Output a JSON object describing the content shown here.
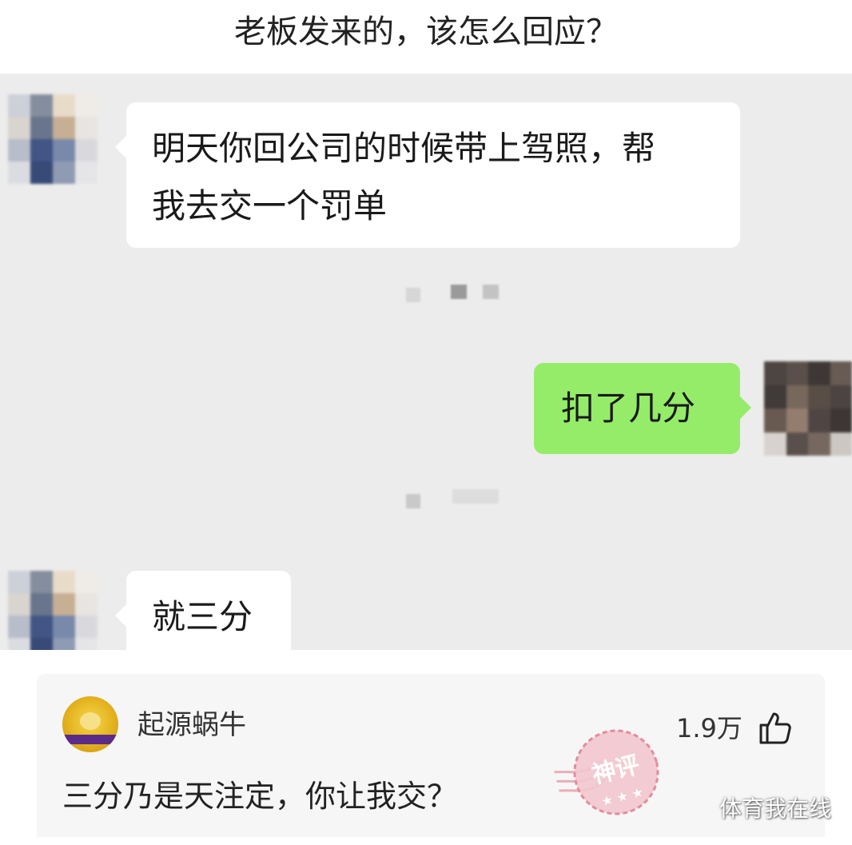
{
  "post": {
    "title": "老板发来的，该怎么回应？"
  },
  "chat": {
    "messages": [
      {
        "side": "left",
        "text_line1": "明天你回公司的时候带上驾照，帮",
        "text_line2": "我去交一个罚单"
      },
      {
        "side": "right",
        "text": "扣了几分"
      },
      {
        "side": "left",
        "text": "就三分"
      }
    ]
  },
  "comment": {
    "username": "起源蜗牛",
    "likes": "1.9万",
    "text": "三分乃是天注定，你让我交？",
    "badge": "神评",
    "avatar_icon": "avatar-muscle-cartoon",
    "like_icon": "thumbs-up-icon"
  },
  "watermark": "体育我在线",
  "colors": {
    "chat_bg": "#ececec",
    "bubble_left": "#ffffff",
    "bubble_right": "#95ec69",
    "stamp": "#e7a1ad"
  }
}
